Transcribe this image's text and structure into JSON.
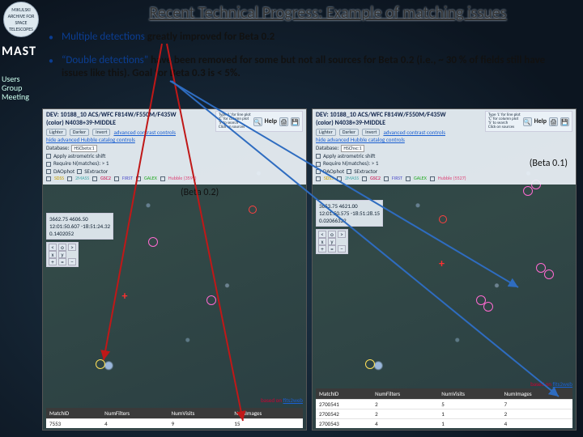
{
  "sidebar": {
    "logo_text": "MIKULSKI ARCHIVE FOR SPACE TELESCOPES",
    "mast": "MAST",
    "users_group": "Users Group",
    "meeting": "Meeting"
  },
  "title": "Recent Technical Progress: Example of matching issues",
  "bullets": [
    {
      "lead": "Multiple detections",
      "rest": " greatly improved for Beta 0.2"
    },
    {
      "lead": "“Double detections”",
      "rest": " have been removed for some but not all sources for Beta 0.2 (i.e., ~ 30 % of fields still have issues like this). Goal for Beta 0.3 is < 5%."
    }
  ],
  "common": {
    "help": "Help",
    "help_note": "Type 'L' for line plot\n'C' for column plot\n'S' to search\nClick on sources",
    "based_on": "based on",
    "fits2web": "fits2web"
  },
  "panel_a": {
    "label": "(Beta 0.2)",
    "hdr_title": "DEV: 10188_10 ACS/WFC F814W/F550M/F435W\n(color) N4038+39-MIDDLE",
    "btn_lighter": "Lighter",
    "btn_darker": "Darker",
    "btn_invert": "Invert",
    "adv_link": "advanced contrast controls",
    "hide_link": "hide advanced Hubble catalog controls",
    "db_label": "Database:",
    "db_value": "HSCbeta:1",
    "chk_astro": "Apply astrometric shift",
    "chk_require": "Require N(matches): > 1",
    "chk_dao": "DAOphot",
    "chk_sext": "SExtractor",
    "cats": [
      "SDSS",
      "2MASS",
      "GSC2",
      "FIRST",
      "GALEX",
      "Hubble (3599)"
    ],
    "coords": "3662.75 4606.50\n12:01:50.607 -18:51:24.32\n0.1402052",
    "table": {
      "headers": [
        "MatchID",
        "NumFilters",
        "NumVisits",
        "NumImages"
      ],
      "rows": [
        [
          "7553",
          "4",
          "9",
          "15"
        ]
      ]
    }
  },
  "panel_b": {
    "label": "(Beta 0.1)",
    "hdr_title": "DEV: 10188_10 ACS/WFC F814W/F550M/F435W\n(color) N4038+39-MIDDLE",
    "btn_lighter": "Lighter",
    "btn_darker": "Darker",
    "btn_invert": "Invert",
    "adv_link": "advanced contrast controls",
    "hide_link": "hide advanced Hubble catalog controls",
    "db_label": "Database:",
    "db_value": "HSChsc:1",
    "chk_astro": "Apply astrometric shift",
    "chk_require": "Require N(matches): > 1",
    "chk_dao": "DAOphot",
    "chk_sext": "SExtractor",
    "cats": [
      "SDSS",
      "2MASS",
      "GSC2",
      "FIRST",
      "GALEX",
      "Hubble (5527)"
    ],
    "coords": "3653.75 4621.00\n12:01:50.575 -18:51:28.15\n0.02066322",
    "table": {
      "headers": [
        "MatchID",
        "NumFilters",
        "NumVisits",
        "NumImages"
      ],
      "rows": [
        [
          "2700541",
          "2",
          "5",
          "7"
        ],
        [
          "2700542",
          "2",
          "1",
          "2"
        ],
        [
          "2700543",
          "4",
          "1",
          "4"
        ]
      ]
    }
  }
}
